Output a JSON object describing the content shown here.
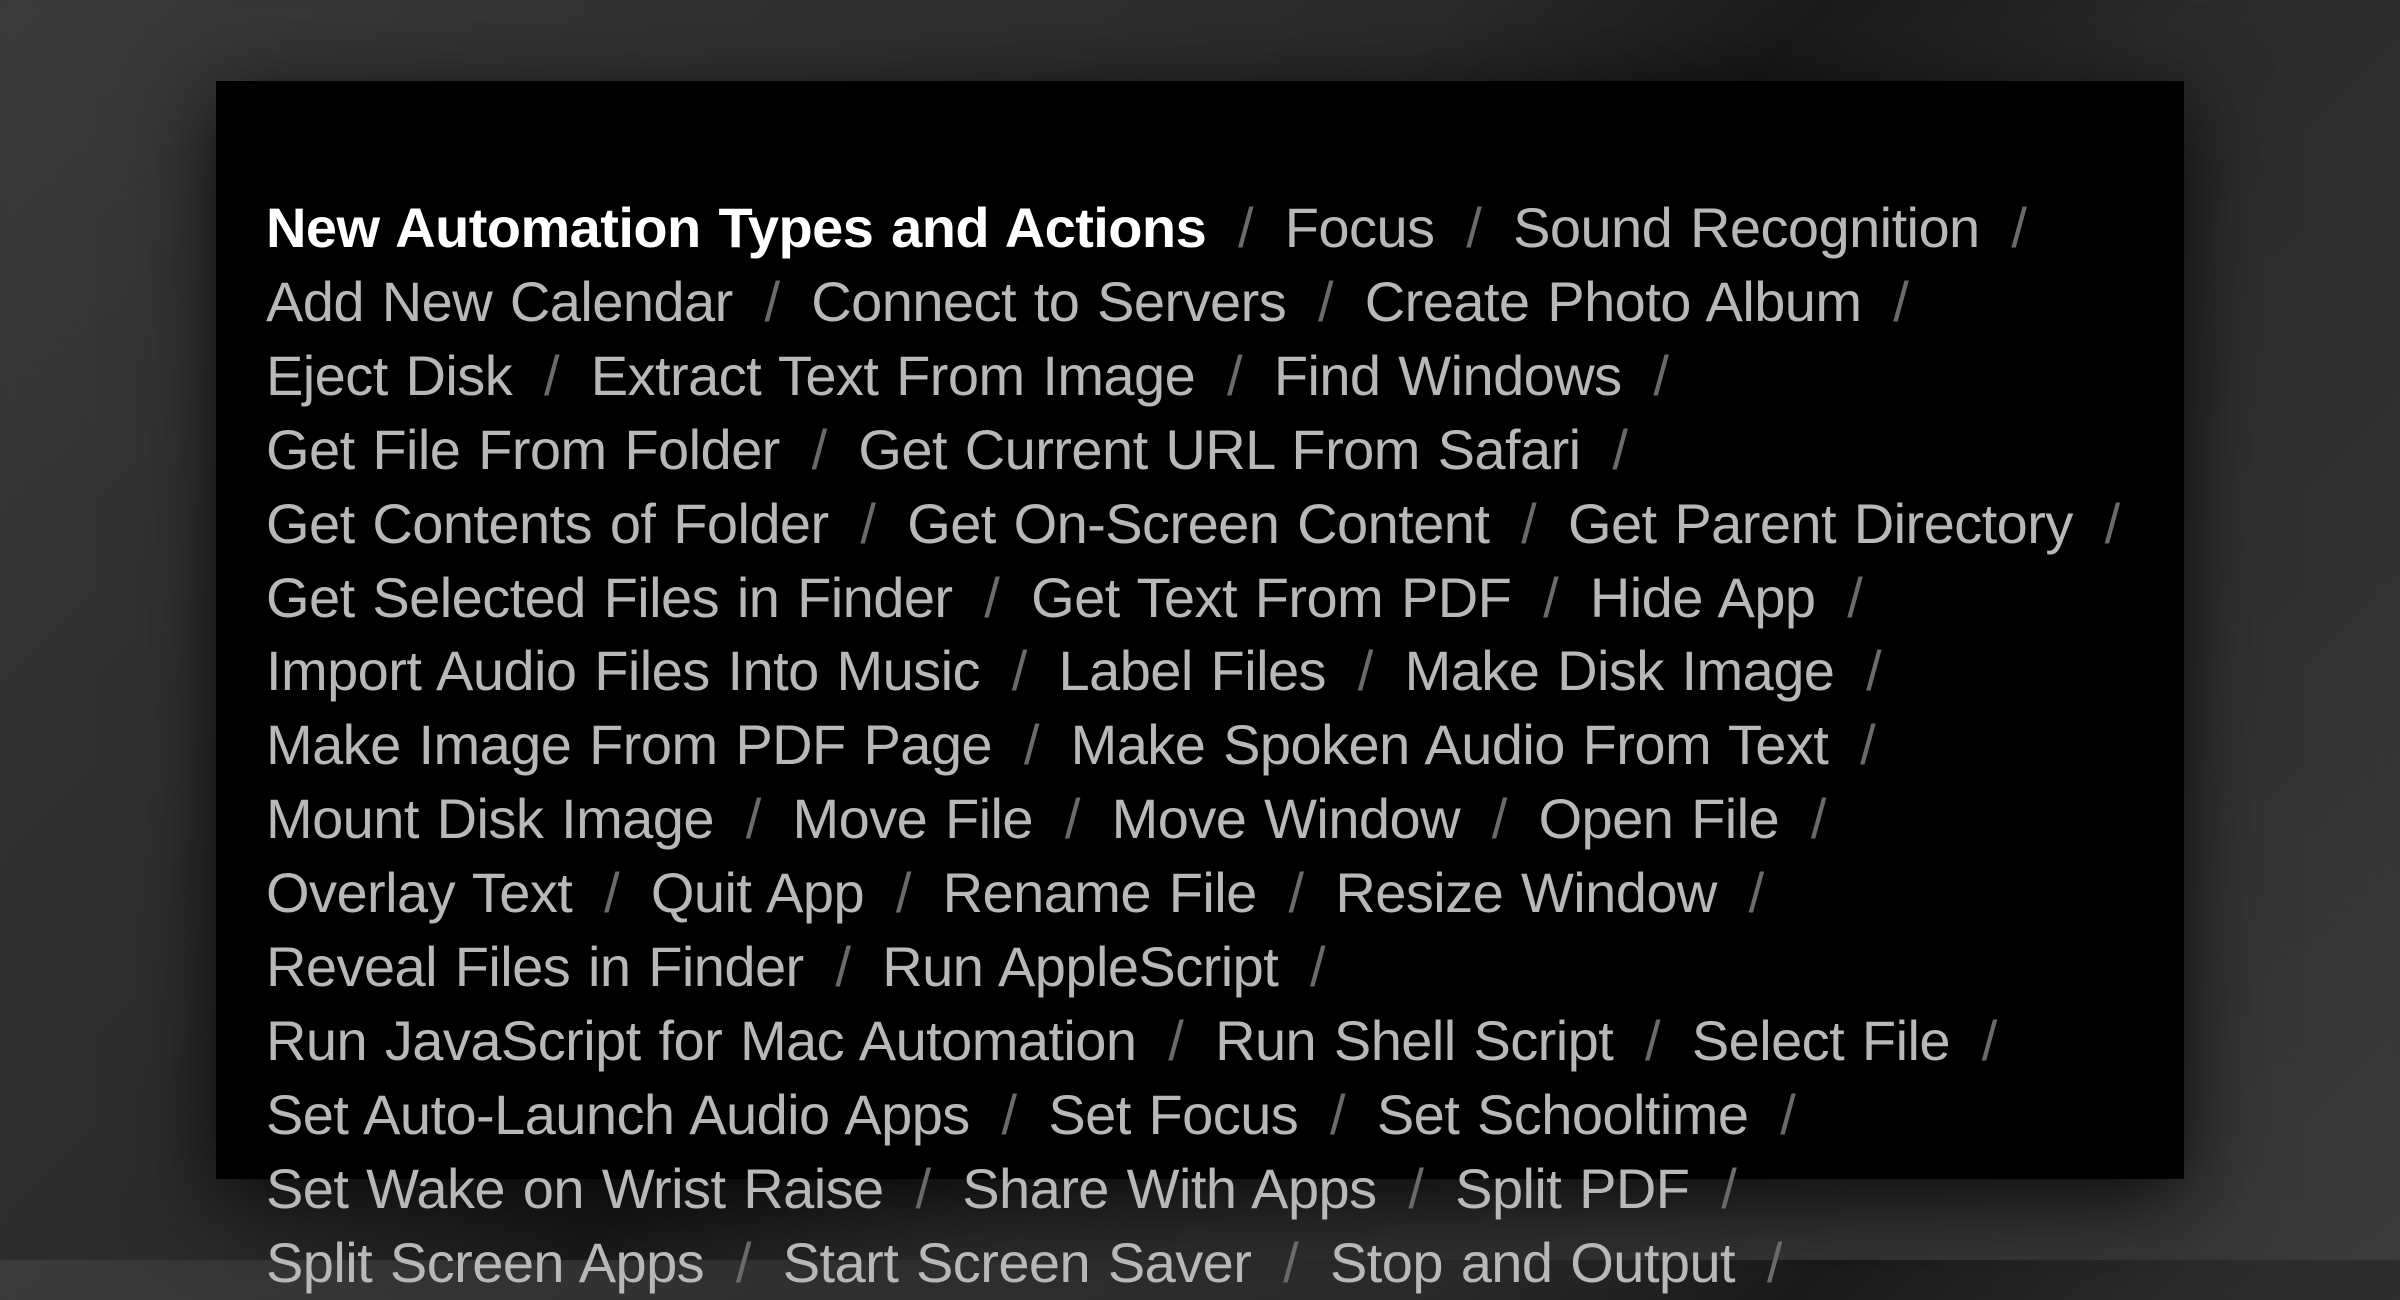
{
  "heading": "New Automation Types and Actions",
  "separator": "/",
  "items": [
    "Focus",
    "Sound Recognition",
    "Add New Calendar",
    "Connect to Servers",
    "Create Photo Album",
    "Eject Disk",
    "Extract Text From Image",
    "Find Windows",
    "Get File From Folder",
    "Get Current URL From Safari",
    "Get Contents of Folder",
    "Get On-Screen Content",
    "Get Parent Directory",
    "Get Selected Files in Finder",
    "Get Text From PDF",
    "Hide App",
    "Import Audio Files Into Music",
    "Label Files",
    "Make Disk Image",
    "Make Image From PDF Page",
    "Make Spoken Audio From Text",
    "Mount Disk Image",
    "Move File",
    "Move Window",
    "Open File",
    "Overlay Text",
    "Quit App",
    "Rename File",
    "Resize Window",
    "Reveal Files in Finder",
    "Run AppleScript",
    "Run JavaScript for Mac Automation",
    "Run Shell Script",
    "Select File",
    "Set Auto-Launch Audio Apps",
    "Set Focus",
    "Set Schooltime",
    "Set Wake on Wrist Raise",
    "Share With Apps",
    "Split PDF",
    "Split Screen Apps",
    "Start Screen Saver",
    "Stop and Output"
  ]
}
